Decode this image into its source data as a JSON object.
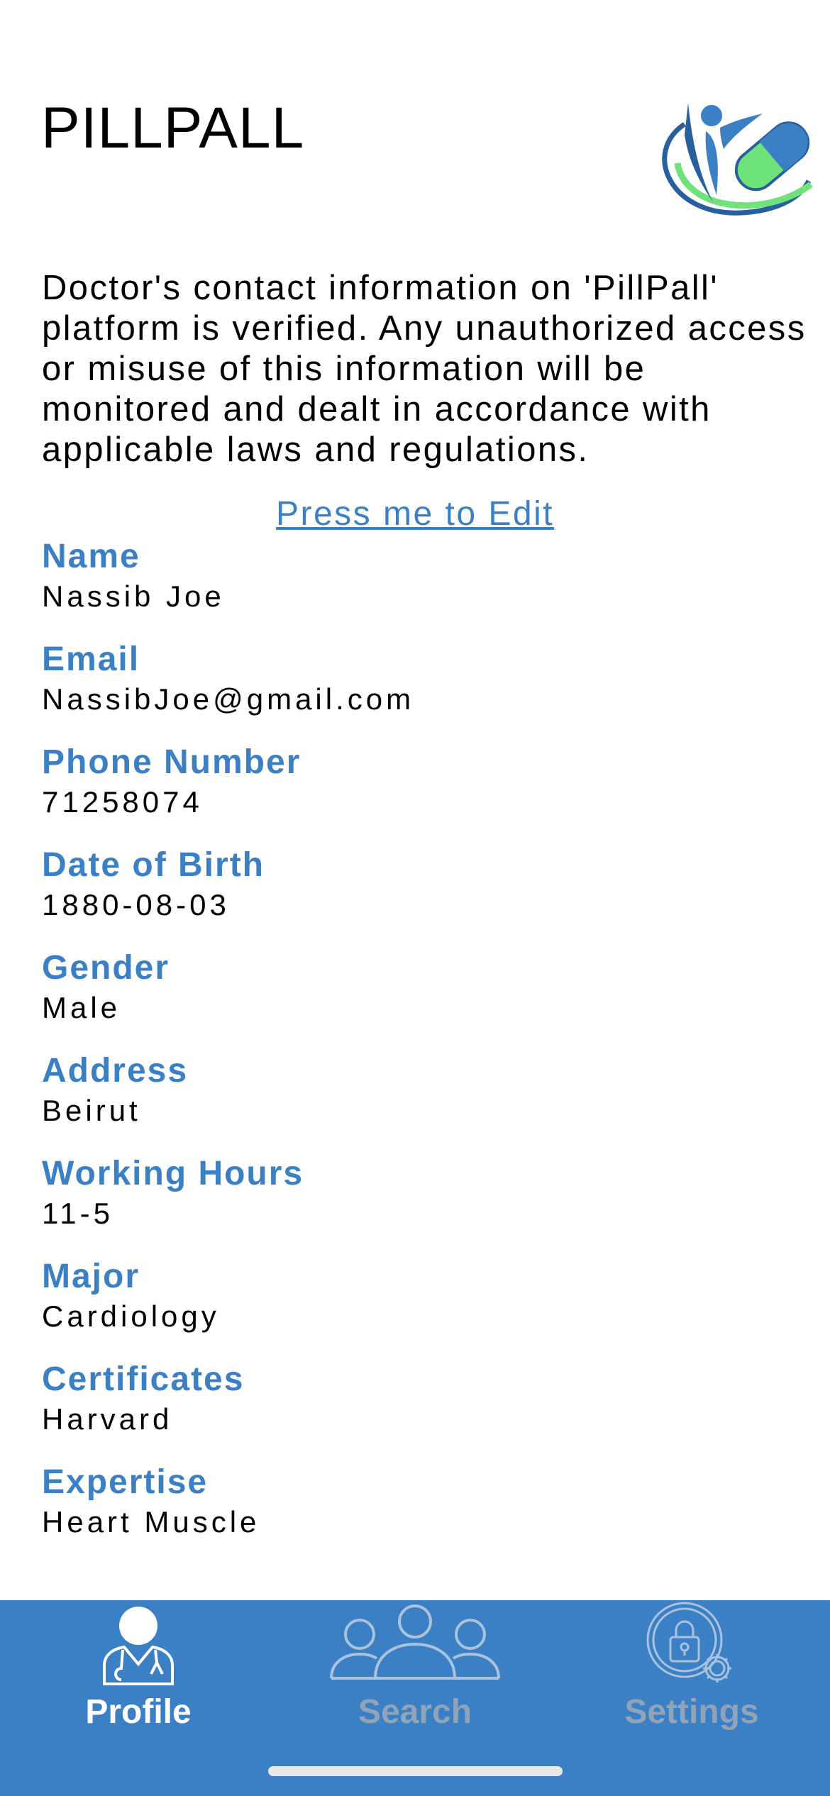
{
  "header": {
    "title": "PILLPALL",
    "logo_icon": "pillpall-logo-icon"
  },
  "notice": {
    "text": "Doctor's contact information on 'PillPall' platform is verified. Any unauthorized access or misuse of this information will be monitored and dealt in accordance with applicable laws and regulations."
  },
  "edit_link": {
    "label": "Press me to Edit"
  },
  "fields": [
    {
      "label": "Name",
      "value": "Nassib Joe"
    },
    {
      "label": "Email",
      "value": "NassibJoe@gmail.com"
    },
    {
      "label": "Phone Number",
      "value": "71258074"
    },
    {
      "label": "Date of Birth",
      "value": "1880-08-03"
    },
    {
      "label": "Gender",
      "value": "Male"
    },
    {
      "label": "Address",
      "value": "Beirut"
    },
    {
      "label": "Working Hours",
      "value": "11-5"
    },
    {
      "label": "Major",
      "value": "Cardiology"
    },
    {
      "label": "Certificates",
      "value": "Harvard"
    },
    {
      "label": "Expertise",
      "value": "Heart Muscle"
    }
  ],
  "tabbar": {
    "tabs": [
      {
        "label": "Profile",
        "icon": "doctor-icon",
        "active": true
      },
      {
        "label": "Search",
        "icon": "people-group-icon",
        "active": false
      },
      {
        "label": "Settings",
        "icon": "lock-gear-icon",
        "active": false
      }
    ]
  },
  "colors": {
    "accent": "#3b7fc4",
    "logo_green": "#6fe27a",
    "logo_dark_blue": "#2a5f9e",
    "inactive_tab": "#8fa4b8"
  }
}
